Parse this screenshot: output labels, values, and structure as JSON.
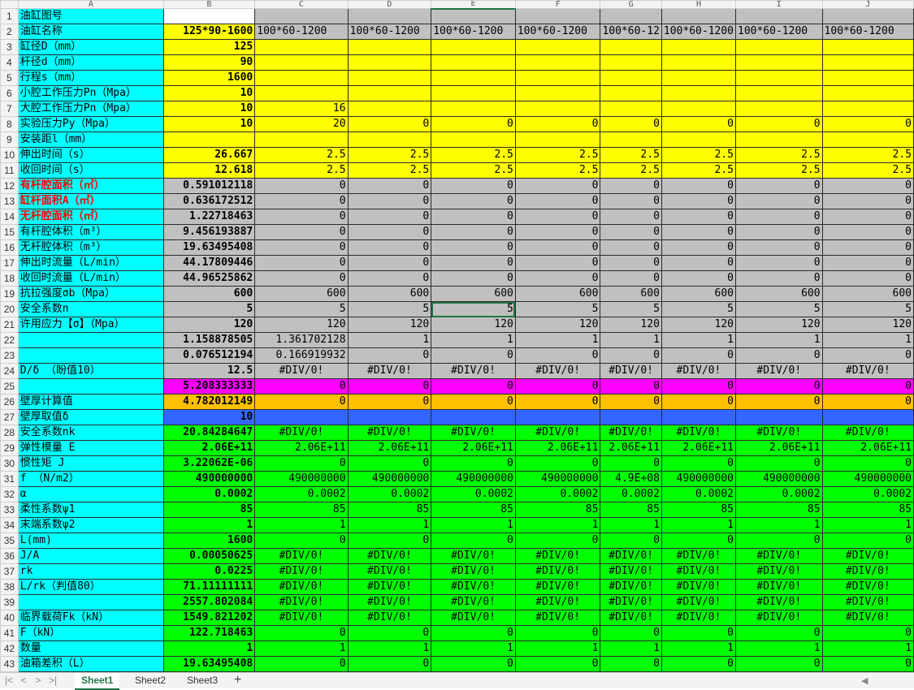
{
  "columns": [
    "A",
    "B",
    "C",
    "D",
    "E",
    "F",
    "G",
    "H",
    "I",
    "J"
  ],
  "colors": {
    "cyan": "#00ffff",
    "yellow": "#ffff00",
    "gray": "#c0c0c0",
    "white": "#ffffff",
    "magenta": "#ff00ff",
    "orange": "#ffc000",
    "blue": "#3366ff",
    "green": "#00ff00"
  },
  "rows": [
    {
      "n": "1",
      "a": "油缸图号",
      "bg": "gray",
      "b": "",
      "bb": "white",
      "v": [
        "",
        "",
        "",
        "",
        "",
        "",
        "",
        ""
      ]
    },
    {
      "n": "2",
      "a": "油缸名称",
      "bg": "gray",
      "b": "125*90-1600",
      "bb": "yellow",
      "v": [
        "100*60-1200",
        "100*60-1200",
        "100*60-1200",
        "100*60-1200",
        "100*60-12",
        "100*60-1200",
        "100*60-1200",
        "100*60-1200"
      ],
      "left": true
    },
    {
      "n": "3",
      "a": "缸径D（mm）",
      "bg": "yellow",
      "b": "125",
      "v": [
        "",
        "",
        "",
        "",
        "",
        "",
        "",
        ""
      ]
    },
    {
      "n": "4",
      "a": "杆径d（mm）",
      "bg": "yellow",
      "b": "90",
      "v": [
        "",
        "",
        "",
        "",
        "",
        "",
        "",
        ""
      ]
    },
    {
      "n": "5",
      "a": "行程s（mm）",
      "bg": "yellow",
      "b": "1600",
      "v": [
        "",
        "",
        "",
        "",
        "",
        "",
        "",
        ""
      ]
    },
    {
      "n": "6",
      "a": "小腔工作压力Pn（Mpa）",
      "bg": "yellow",
      "b": "10",
      "v": [
        "",
        "",
        "",
        "",
        "",
        "",
        "",
        ""
      ]
    },
    {
      "n": "7",
      "a": "大腔工作压力Pn（Mpa）",
      "bg": "yellow",
      "b": "10",
      "v": [
        "16",
        "",
        "",
        "",
        "",
        "",
        "",
        ""
      ]
    },
    {
      "n": "8",
      "a": "实验压力Py（Mpa）",
      "bg": "yellow",
      "b": "10",
      "v": [
        "20",
        "0",
        "0",
        "0",
        "0",
        "0",
        "0",
        "0"
      ]
    },
    {
      "n": "9",
      "a": "安装距l（mm）",
      "bg": "yellow",
      "b": "",
      "v": [
        "",
        "",
        "",
        "",
        "",
        "",
        "",
        ""
      ]
    },
    {
      "n": "10",
      "a": "伸出时间（s）",
      "bg": "yellow",
      "b": "26.667",
      "v": [
        "2.5",
        "2.5",
        "2.5",
        "2.5",
        "2.5",
        "2.5",
        "2.5",
        "2.5"
      ]
    },
    {
      "n": "11",
      "a": "收回时间（s）",
      "bg": "yellow",
      "b": "12.618",
      "v": [
        "2.5",
        "2.5",
        "2.5",
        "2.5",
        "2.5",
        "2.5",
        "2.5",
        "2.5"
      ]
    },
    {
      "n": "12",
      "a": "有杆腔面积（㎡）",
      "bg": "gray",
      "b": "0.591012118",
      "red": true,
      "v": [
        "0",
        "0",
        "0",
        "0",
        "0",
        "0",
        "0",
        "0"
      ]
    },
    {
      "n": "13",
      "a": "缸杆面积A（㎡）",
      "bg": "gray",
      "b": "0.636172512",
      "red": true,
      "v": [
        "0",
        "0",
        "0",
        "0",
        "0",
        "0",
        "0",
        "0"
      ]
    },
    {
      "n": "14",
      "a": "无杆腔面积（㎡）",
      "bg": "gray",
      "b": "1.22718463",
      "red": true,
      "v": [
        "0",
        "0",
        "0",
        "0",
        "0",
        "0",
        "0",
        "0"
      ]
    },
    {
      "n": "15",
      "a": "有杆腔体积（m³）",
      "bg": "gray",
      "b": "9.456193887",
      "v": [
        "0",
        "0",
        "0",
        "0",
        "0",
        "0",
        "0",
        "0"
      ]
    },
    {
      "n": "16",
      "a": "无杆腔体积（m³）",
      "bg": "gray",
      "b": "19.63495408",
      "v": [
        "0",
        "0",
        "0",
        "0",
        "0",
        "0",
        "0",
        "0"
      ]
    },
    {
      "n": "17",
      "a": "伸出时流量（L/min）",
      "bg": "gray",
      "b": "44.17809446",
      "v": [
        "0",
        "0",
        "0",
        "0",
        "0",
        "0",
        "0",
        "0"
      ]
    },
    {
      "n": "18",
      "a": "收回时流量（L/min）",
      "bg": "gray",
      "b": "44.96525862",
      "v": [
        "0",
        "0",
        "0",
        "0",
        "0",
        "0",
        "0",
        "0"
      ]
    },
    {
      "n": "19",
      "a": "抗拉强度σb（Mpa）",
      "bg": "gray",
      "b": "600",
      "v": [
        "600",
        "600",
        "600",
        "600",
        "600",
        "600",
        "600",
        "600"
      ]
    },
    {
      "n": "20",
      "a": "安全系数n",
      "bg": "gray",
      "b": "5",
      "v": [
        "5",
        "5",
        "5",
        "5",
        "5",
        "5",
        "5",
        "5"
      ]
    },
    {
      "n": "21",
      "a": "许用应力【σ】（Mpa）",
      "bg": "gray",
      "b": "120",
      "v": [
        "120",
        "120",
        "120",
        "120",
        "120",
        "120",
        "120",
        "120"
      ]
    },
    {
      "n": "22",
      "a": "",
      "bg": "gray",
      "b": "1.158878505",
      "v": [
        "1.361702128",
        "1",
        "1",
        "1",
        "1",
        "1",
        "1",
        "1"
      ]
    },
    {
      "n": "23",
      "a": "",
      "bg": "gray",
      "b": "0.076512194",
      "v": [
        "0.166919932",
        "0",
        "0",
        "0",
        "0",
        "0",
        "0",
        "0"
      ]
    },
    {
      "n": "24",
      "a": "D/δ （盼值10）",
      "bg": "gray",
      "b": "12.5",
      "v": [
        "#DIV/0!",
        "#DIV/0!",
        "#DIV/0!",
        "#DIV/0!",
        "#DIV/0!",
        "#DIV/0!",
        "#DIV/0!",
        "#DIV/0!"
      ]
    },
    {
      "n": "25",
      "a": "",
      "bg": "magenta",
      "b": "5.208333333",
      "v": [
        "0",
        "0",
        "0",
        "0",
        "0",
        "0",
        "0",
        "0"
      ]
    },
    {
      "n": "26",
      "a": "壁厚计算值",
      "bg": "orange",
      "b": "4.782012149",
      "v": [
        "0",
        "0",
        "0",
        "0",
        "0",
        "0",
        "0",
        "0"
      ]
    },
    {
      "n": "27",
      "a": "壁厚取值δ",
      "bg": "blue",
      "b": "10",
      "v": [
        "",
        "",
        "",
        "",
        "",
        "",
        "",
        ""
      ]
    },
    {
      "n": "28",
      "a": "安全系数nk",
      "bg": "green",
      "b": "20.84284647",
      "v": [
        "#DIV/0!",
        "#DIV/0!",
        "#DIV/0!",
        "#DIV/0!",
        "#DIV/0!",
        "#DIV/0!",
        "#DIV/0!",
        "#DIV/0!"
      ]
    },
    {
      "n": "29",
      "a": "弹性模量  E",
      "bg": "green",
      "b": "2.06E+11",
      "v": [
        "2.06E+11",
        "2.06E+11",
        "2.06E+11",
        "2.06E+11",
        "2.06E+11",
        "2.06E+11",
        "2.06E+11",
        "2.06E+11"
      ]
    },
    {
      "n": "30",
      "a": "惯性矩  J",
      "bg": "green",
      "b": "3.22062E-06",
      "v": [
        "0",
        "0",
        "0",
        "0",
        "0",
        "0",
        "0",
        "0"
      ]
    },
    {
      "n": "31",
      "a": "f  （N/m2）",
      "bg": "green",
      "b": "490000000",
      "v": [
        "490000000",
        "490000000",
        "490000000",
        "490000000",
        "4.9E+08",
        "490000000",
        "490000000",
        "490000000"
      ]
    },
    {
      "n": "32",
      "a": "α",
      "bg": "green",
      "b": "0.0002",
      "v": [
        "0.0002",
        "0.0002",
        "0.0002",
        "0.0002",
        "0.0002",
        "0.0002",
        "0.0002",
        "0.0002"
      ]
    },
    {
      "n": "33",
      "a": "柔性系数ψ1",
      "bg": "green",
      "b": "85",
      "v": [
        "85",
        "85",
        "85",
        "85",
        "85",
        "85",
        "85",
        "85"
      ]
    },
    {
      "n": "34",
      "a": "末端系数ψ2",
      "bg": "green",
      "b": "1",
      "v": [
        "1",
        "1",
        "1",
        "1",
        "1",
        "1",
        "1",
        "1"
      ]
    },
    {
      "n": "35",
      "a": "L(mm)",
      "bg": "green",
      "b": "1600",
      "v": [
        "0",
        "0",
        "0",
        "0",
        "0",
        "0",
        "0",
        "0"
      ]
    },
    {
      "n": "36",
      "a": "J/A",
      "bg": "green",
      "b": "0.00050625",
      "v": [
        "#DIV/0!",
        "#DIV/0!",
        "#DIV/0!",
        "#DIV/0!",
        "#DIV/0!",
        "#DIV/0!",
        "#DIV/0!",
        "#DIV/0!"
      ]
    },
    {
      "n": "37",
      "a": "rk",
      "bg": "green",
      "b": "0.0225",
      "v": [
        "#DIV/0!",
        "#DIV/0!",
        "#DIV/0!",
        "#DIV/0!",
        "#DIV/0!",
        "#DIV/0!",
        "#DIV/0!",
        "#DIV/0!"
      ]
    },
    {
      "n": "38",
      "a": "L/rk（判值80）",
      "bg": "green",
      "b": "71.11111111",
      "v": [
        "#DIV/0!",
        "#DIV/0!",
        "#DIV/0!",
        "#DIV/0!",
        "#DIV/0!",
        "#DIV/0!",
        "#DIV/0!",
        "#DIV/0!"
      ]
    },
    {
      "n": "39",
      "a": "",
      "bg": "green",
      "b": "2557.802084",
      "v": [
        "#DIV/0!",
        "#DIV/0!",
        "#DIV/0!",
        "#DIV/0!",
        "#DIV/0!",
        "#DIV/0!",
        "#DIV/0!",
        "#DIV/0!"
      ]
    },
    {
      "n": "40",
      "a": "临界载荷Fk（kN）",
      "bg": "green",
      "b": "1549.821202",
      "v": [
        "#DIV/0!",
        "#DIV/0!",
        "#DIV/0!",
        "#DIV/0!",
        "#DIV/0!",
        "#DIV/0!",
        "#DIV/0!",
        "#DIV/0!"
      ]
    },
    {
      "n": "41",
      "a": "F（kN）",
      "bg": "green",
      "b": "122.718463",
      "v": [
        "0",
        "0",
        "0",
        "0",
        "0",
        "0",
        "0",
        "0"
      ]
    },
    {
      "n": "42",
      "a": "数量",
      "bg": "green",
      "b": "1",
      "v": [
        "1",
        "1",
        "1",
        "1",
        "1",
        "1",
        "1",
        "1"
      ]
    },
    {
      "n": "43",
      "a": "油箱差积（L）",
      "bg": "green",
      "b": "19.63495408",
      "v": [
        "0",
        "0",
        "0",
        "0",
        "0",
        "0",
        "0",
        "0"
      ]
    }
  ],
  "sheets": [
    "Sheet1",
    "Sheet2",
    "Sheet3"
  ],
  "active_sheet": "Sheet1",
  "add_sheet_label": "+",
  "nav": [
    "|<",
    "<",
    ">",
    ">|"
  ]
}
